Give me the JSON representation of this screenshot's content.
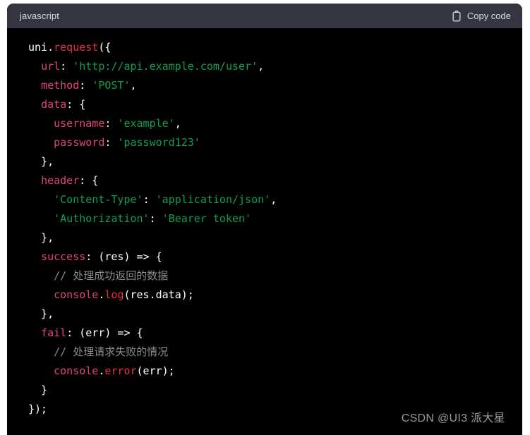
{
  "card": {
    "header": {
      "language_label": "javascript",
      "copy_label": "Copy code",
      "copy_icon": "clipboard-icon"
    },
    "colors": {
      "header_background": "#343541",
      "code_background": "#000000",
      "page_background": "#ffffff",
      "property_key": "#e0457b",
      "function_name": "#ea2b46",
      "string": "#0f9e52",
      "comment": "#8b8b8b",
      "plain_text": "#ffffff",
      "header_text": "#d9d9e3",
      "watermark_text": "#9a9a9a"
    },
    "code": {
      "language": "javascript",
      "lines": [
        [
          {
            "t": "uni",
            "c": "plain"
          },
          {
            "t": ".",
            "c": "punct"
          },
          {
            "t": "request",
            "c": "fn"
          },
          {
            "t": "({",
            "c": "punct"
          }
        ],
        [
          {
            "t": "  ",
            "c": "plain"
          },
          {
            "t": "url",
            "c": "prop"
          },
          {
            "t": ": ",
            "c": "punct"
          },
          {
            "t": "'http://api.example.com/user'",
            "c": "str"
          },
          {
            "t": ",",
            "c": "punct"
          }
        ],
        [
          {
            "t": "  ",
            "c": "plain"
          },
          {
            "t": "method",
            "c": "prop"
          },
          {
            "t": ": ",
            "c": "punct"
          },
          {
            "t": "'POST'",
            "c": "str"
          },
          {
            "t": ",",
            "c": "punct"
          }
        ],
        [
          {
            "t": "  ",
            "c": "plain"
          },
          {
            "t": "data",
            "c": "prop"
          },
          {
            "t": ": {",
            "c": "punct"
          }
        ],
        [
          {
            "t": "    ",
            "c": "plain"
          },
          {
            "t": "username",
            "c": "prop"
          },
          {
            "t": ": ",
            "c": "punct"
          },
          {
            "t": "'example'",
            "c": "str"
          },
          {
            "t": ",",
            "c": "punct"
          }
        ],
        [
          {
            "t": "    ",
            "c": "plain"
          },
          {
            "t": "password",
            "c": "prop"
          },
          {
            "t": ": ",
            "c": "punct"
          },
          {
            "t": "'password123'",
            "c": "str"
          }
        ],
        [
          {
            "t": "  },",
            "c": "punct"
          }
        ],
        [
          {
            "t": "  ",
            "c": "plain"
          },
          {
            "t": "header",
            "c": "prop"
          },
          {
            "t": ": {",
            "c": "punct"
          }
        ],
        [
          {
            "t": "    ",
            "c": "plain"
          },
          {
            "t": "'Content-Type'",
            "c": "strkey"
          },
          {
            "t": ": ",
            "c": "punct"
          },
          {
            "t": "'application/json'",
            "c": "str"
          },
          {
            "t": ",",
            "c": "punct"
          }
        ],
        [
          {
            "t": "    ",
            "c": "plain"
          },
          {
            "t": "'Authorization'",
            "c": "strkey"
          },
          {
            "t": ": ",
            "c": "punct"
          },
          {
            "t": "'Bearer token'",
            "c": "str"
          }
        ],
        [
          {
            "t": "  },",
            "c": "punct"
          }
        ],
        [
          {
            "t": "  ",
            "c": "plain"
          },
          {
            "t": "success",
            "c": "prop"
          },
          {
            "t": ": (",
            "c": "punct"
          },
          {
            "t": "res",
            "c": "plain"
          },
          {
            "t": ") => {",
            "c": "punct"
          }
        ],
        [
          {
            "t": "    ",
            "c": "plain"
          },
          {
            "t": "// 处理成功返回的数据",
            "c": "comment"
          }
        ],
        [
          {
            "t": "    ",
            "c": "plain"
          },
          {
            "t": "console",
            "c": "prop"
          },
          {
            "t": ".",
            "c": "punct"
          },
          {
            "t": "log",
            "c": "fn"
          },
          {
            "t": "(res.data);",
            "c": "plain"
          }
        ],
        [
          {
            "t": "  },",
            "c": "punct"
          }
        ],
        [
          {
            "t": "  ",
            "c": "plain"
          },
          {
            "t": "fail",
            "c": "prop"
          },
          {
            "t": ": (",
            "c": "punct"
          },
          {
            "t": "err",
            "c": "plain"
          },
          {
            "t": ") => {",
            "c": "punct"
          }
        ],
        [
          {
            "t": "    ",
            "c": "plain"
          },
          {
            "t": "// 处理请求失败的情况",
            "c": "comment"
          }
        ],
        [
          {
            "t": "    ",
            "c": "plain"
          },
          {
            "t": "console",
            "c": "prop"
          },
          {
            "t": ".",
            "c": "punct"
          },
          {
            "t": "error",
            "c": "fn"
          },
          {
            "t": "(err);",
            "c": "plain"
          }
        ],
        [
          {
            "t": "  }",
            "c": "punct"
          }
        ],
        [
          {
            "t": "});",
            "c": "punct"
          }
        ]
      ]
    },
    "watermark": "CSDN @UI3 派大星"
  }
}
